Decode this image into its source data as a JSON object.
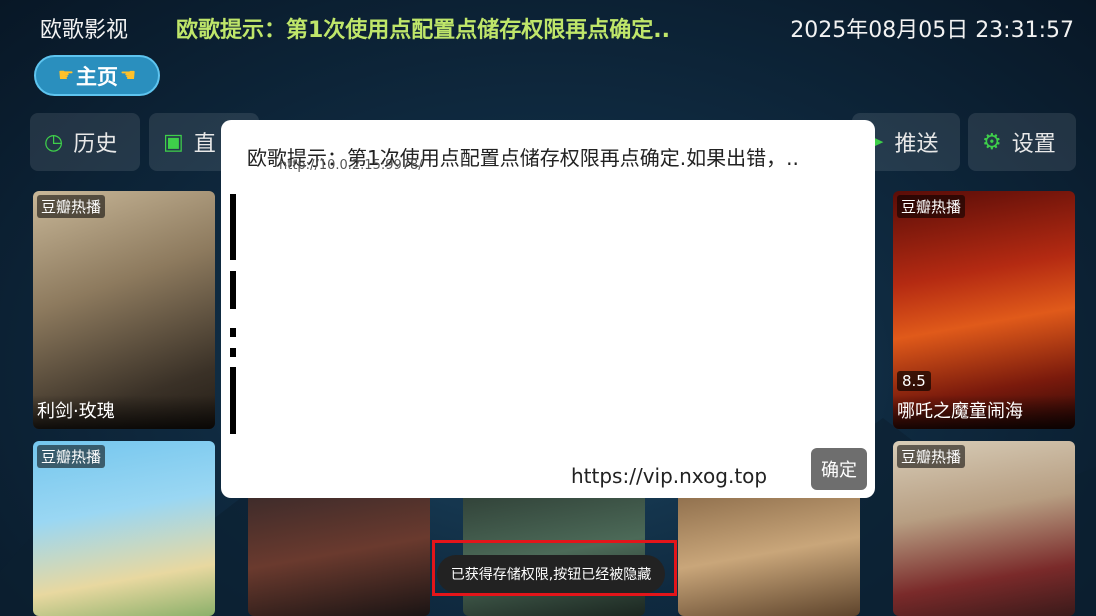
{
  "header": {
    "app_title": "欧歌影视",
    "marquee": "欧歌提示：第1次使用点配置点储存权限再点确定..",
    "datetime": "2025年08月05日 23:31:57"
  },
  "home": {
    "label": "主页"
  },
  "nav": {
    "history": "历史",
    "live": "直",
    "push": "推送",
    "settings": "设置"
  },
  "cards": [
    {
      "tag": "豆瓣热播",
      "title": "利剑·玫瑰"
    },
    {
      "tag": "豆瓣热播",
      "title": "哪吒之魔童闹海",
      "score": "8.5"
    },
    {
      "tag": "豆瓣热播"
    },
    {
      "tag": "豆瓣热播"
    }
  ],
  "dialog": {
    "message": "欧歌提示：第1次使用点配置点储存权限再点确定.如果出错，..",
    "url": "http://10.0.2.15:9978/",
    "site": "https://vip.nxog.top",
    "ok_label": "确定"
  },
  "toast": {
    "text": "已获得存储权限,按钮已经被隐藏"
  },
  "colors": {
    "accent_green": "#bfe66a",
    "home_blue": "#2a8fbe",
    "toast_frame": "#e3151a"
  }
}
